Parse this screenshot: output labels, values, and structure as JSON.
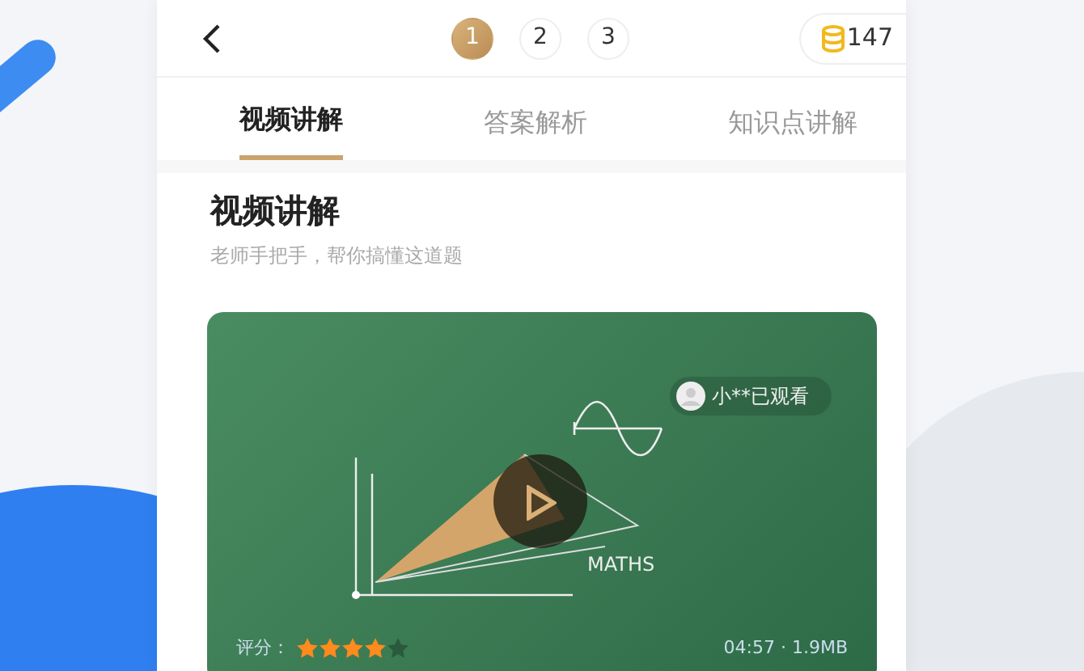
{
  "top_bar": {
    "pages": [
      {
        "label": "1",
        "selected": true
      },
      {
        "label": "2",
        "selected": false
      },
      {
        "label": "3",
        "selected": false
      }
    ],
    "coins": "147"
  },
  "tabs": [
    {
      "label": "视频讲解",
      "selected": true
    },
    {
      "label": "答案解析",
      "selected": false
    },
    {
      "label": "知识点讲解",
      "selected": false
    }
  ],
  "section": {
    "title": "视频讲解",
    "subtitle": "老师手把手，帮你搞懂这道题"
  },
  "video": {
    "viewers": [
      {
        "text": "小**已观看"
      }
    ],
    "caption": "MATHS",
    "rating_label": "评分：",
    "stars": 4,
    "meta": "04:57 · 1.9MB"
  }
}
